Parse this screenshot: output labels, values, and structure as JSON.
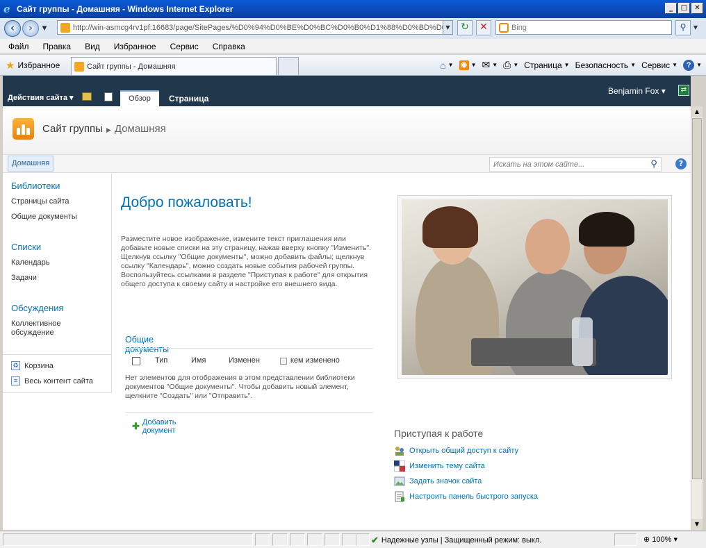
{
  "window": {
    "title": "Сайт группы - Домашняя - Windows Internet Explorer",
    "url": "http://win-asmcg4rv1pf:16683/page/SitePages/%D0%94%D0%BE%D0%BC%D0%B0%D1%88%D0%BD%D0",
    "search_placeholder": "Bing",
    "tab_title": "Сайт группы - Домашняя"
  },
  "menu": [
    "Файл",
    "Правка",
    "Вид",
    "Избранное",
    "Сервис",
    "Справка"
  ],
  "favorites_label": "Избранное",
  "commandbar": {
    "page": "Страница",
    "safety": "Безопасность",
    "tools": "Сервис"
  },
  "ribbon": {
    "site_actions": "Действия сайта",
    "tab_browse": "Обзор",
    "tab_page": "Страница",
    "user": "Benjamin Fox"
  },
  "breadcrumb": {
    "site": "Сайт группы",
    "page": "Домашняя"
  },
  "topnav": {
    "home": "Домашняя",
    "search_placeholder": "Искать на этом сайте..."
  },
  "leftnav": {
    "libraries": "Библиотеки",
    "libraries_items": [
      "Страницы сайта",
      "Общие документы"
    ],
    "lists": "Списки",
    "lists_items": [
      "Календарь",
      "Задачи"
    ],
    "discussions": "Обсуждения",
    "discussion_item": "Коллективное обсуждение",
    "recycle_bin": "Корзина",
    "all_content": "Весь контент сайта"
  },
  "main": {
    "welcome": "Добро пожаловать!",
    "intro": "Разместите новое изображение, измените текст приглашения или добавьте новые списки на эту страницу, нажав вверху кнопку \"Изменить\". Щелкнув ссылку \"Общие документы\", можно добавить файлы; щелкнув ссылку \"Календарь\", можно создать новые события рабочей группы. Воспользуйтесь ссылками в разделе \"Приступая к работе\" для открытия общего доступа к своему сайту и настройке его внешнего вида.",
    "docs_title": "Общие документы",
    "doc_columns": [
      "Тип",
      "Имя",
      "Изменен",
      "кем изменено"
    ],
    "empty_message": "Нет элементов для отображения в этом представлении библиотеки документов \"Общие документы\". Чтобы добавить новый элемент, щелкните \"Создать\" или \"Отправить\".",
    "add_document": "Добавить документ"
  },
  "getting_started": {
    "title": "Приступая к работе",
    "items": [
      "Открыть общий доступ к сайту",
      "Изменить тему сайта",
      "Задать значок сайта",
      "Настроить панель быстрого запуска"
    ]
  },
  "statusbar": {
    "zone": "Надежные узлы | Защищенный режим: выкл.",
    "zoom": "100%"
  }
}
